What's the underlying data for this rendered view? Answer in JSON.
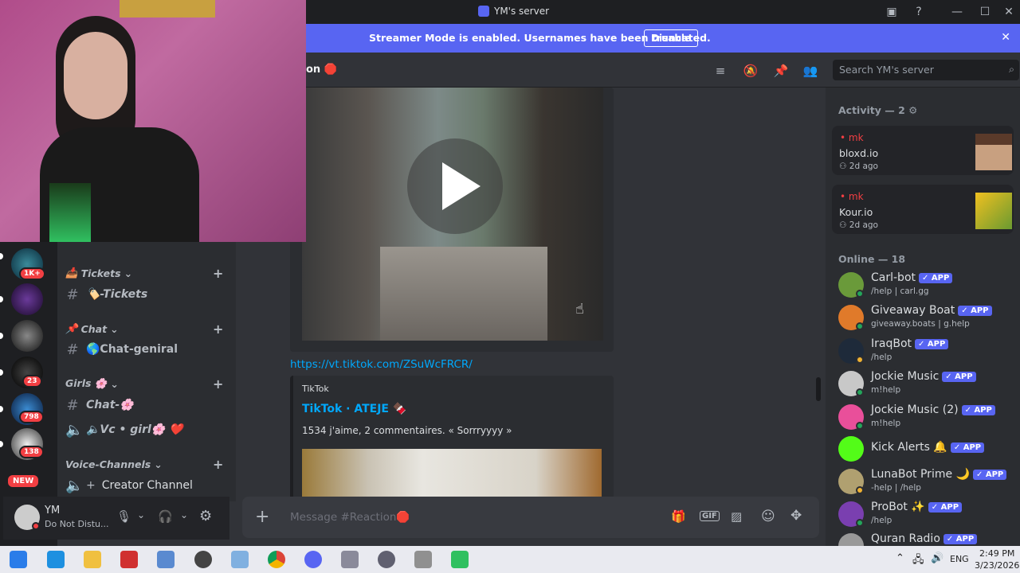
{
  "window": {
    "title": "YM's server"
  },
  "banner": {
    "text": "Streamer Mode is enabled. Usernames have been truncated.",
    "button": "Disable"
  },
  "servers": [
    {
      "badge": "1K+"
    },
    {
      "badge": ""
    },
    {
      "badge": ""
    },
    {
      "badge": "23"
    },
    {
      "badge": "798"
    },
    {
      "badge": "138"
    },
    {
      "badge": "NEW"
    }
  ],
  "sidebar": {
    "categories": [
      {
        "label": "Tickets"
      },
      {
        "label": "Chat"
      },
      {
        "label": "Girls 🌸"
      },
      {
        "label": "Voice-Channels"
      }
    ],
    "channels": [
      {
        "label": "🏷️-Tickets"
      },
      {
        "label": "🌎Chat-geniral"
      },
      {
        "label": "Chat-🌸"
      },
      {
        "label": "🔈Vc • girl🌸 ❤️"
      },
      {
        "label": "Creator Channel"
      }
    ]
  },
  "user": {
    "name": "YM",
    "status": "Do Not Distu..."
  },
  "header": {
    "channel_partial": "on 🛑",
    "search_placeholder": "Search YM's server"
  },
  "chat": {
    "link": "https://vt.tiktok.com/ZSuWcFRCR/",
    "embed": {
      "provider": "TikTok",
      "title": "TikTok · ATEJE 🍫",
      "description": "1534 j'aime, 2 commentaires. « Sorrryyyy »"
    },
    "composer_placeholder": "Message #Reaction🛑"
  },
  "members": {
    "activity_header": "Activity — 2",
    "activities": [
      {
        "user": "mk",
        "game": "bloxd.io",
        "time": "2d ago"
      },
      {
        "user": "mk",
        "game": "Kour.io",
        "time": "2d ago"
      }
    ],
    "online_header": "Online — 18",
    "list": [
      {
        "name": "Carl-bot",
        "sub": "/help | carl.gg",
        "app": "APP",
        "color": "#6a9a3a"
      },
      {
        "name": "Giveaway Boat",
        "sub": "giveaway.boats | g.help",
        "app": "APP",
        "color": "#e07a2a"
      },
      {
        "name": "IraqBot",
        "sub": "/help",
        "app": "APP",
        "color": "#1e2a3a"
      },
      {
        "name": "Jockie Music",
        "sub": "m!help",
        "app": "APP",
        "color": "#c8c8c8"
      },
      {
        "name": "Jockie Music (2)",
        "sub": "m!help",
        "app": "APP",
        "color": "#e94f9a"
      },
      {
        "name": "Kick Alerts 🔔",
        "sub": "",
        "app": "APP",
        "color": "#53fc18"
      },
      {
        "name": "LunaBot Prime 🌙",
        "sub": "-help | /help",
        "app": "APP",
        "color": "#b0a070"
      },
      {
        "name": "ProBot ✨",
        "sub": "/help",
        "app": "APP",
        "color": "#7a3fb0"
      },
      {
        "name": "Quran Radio",
        "sub": "",
        "app": "APP",
        "color": "#999999"
      }
    ]
  },
  "taskbar": {
    "lang": "ENG",
    "time": "2:49 PM",
    "date": "3/23/2026"
  }
}
